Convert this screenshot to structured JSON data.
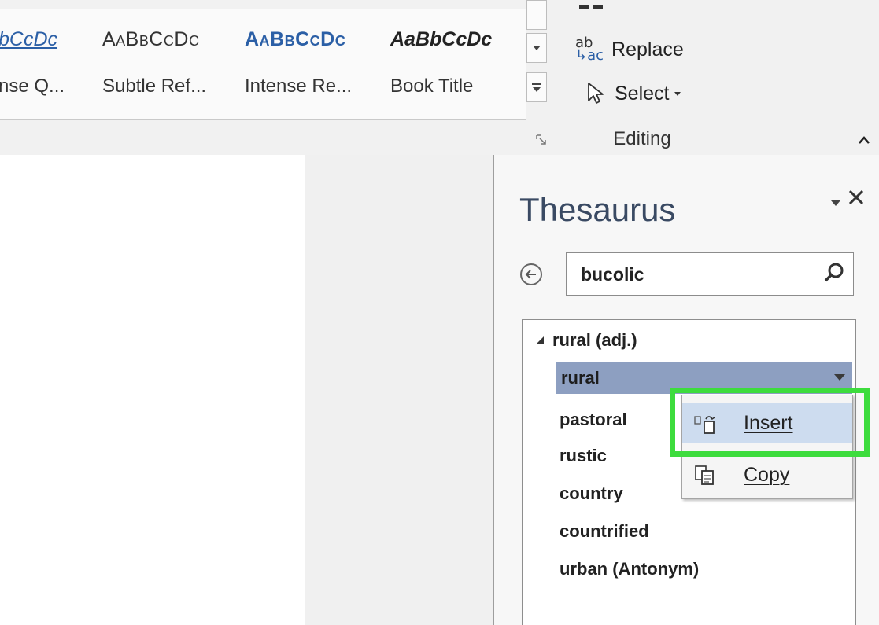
{
  "styles_gallery": {
    "styles": [
      {
        "sample": "bCcDc",
        "name": "nse Q..."
      },
      {
        "sample": "AaBbCcDc",
        "name": "Subtle Ref..."
      },
      {
        "sample": "AaBbCcDc",
        "name": "Intense Re..."
      },
      {
        "sample": "AaBbCcDc",
        "name": "Book Title"
      }
    ]
  },
  "editing": {
    "replace_label": "Replace",
    "replace_icon_top": "ab",
    "replace_icon_bottom": "ac",
    "select_label": "Select",
    "group_label": "Editing"
  },
  "thesaurus": {
    "title": "Thesaurus",
    "search_value": "bucolic",
    "meaning": "rural (adj.)",
    "selected_synonym": "rural",
    "synonyms": [
      "pastoral",
      "rustic",
      "country",
      "countrified",
      "urban (Antonym)"
    ]
  },
  "context_menu": {
    "insert_label": "Insert",
    "copy_label": "Copy"
  },
  "colors": {
    "highlight": "#3ddc3d",
    "selection": "#8d9fc1",
    "accent": "#2b5fa6"
  },
  "icons": [
    "scroll-up-icon",
    "more-styles-icon",
    "dialog-launcher-icon",
    "replace-icon",
    "select-cursor-icon",
    "collapse-ribbon-icon",
    "pane-options-icon",
    "close-icon",
    "back-arrow-icon",
    "search-icon",
    "expand-triangle-icon",
    "dropdown-arrow-icon",
    "insert-icon",
    "copy-icon"
  ]
}
